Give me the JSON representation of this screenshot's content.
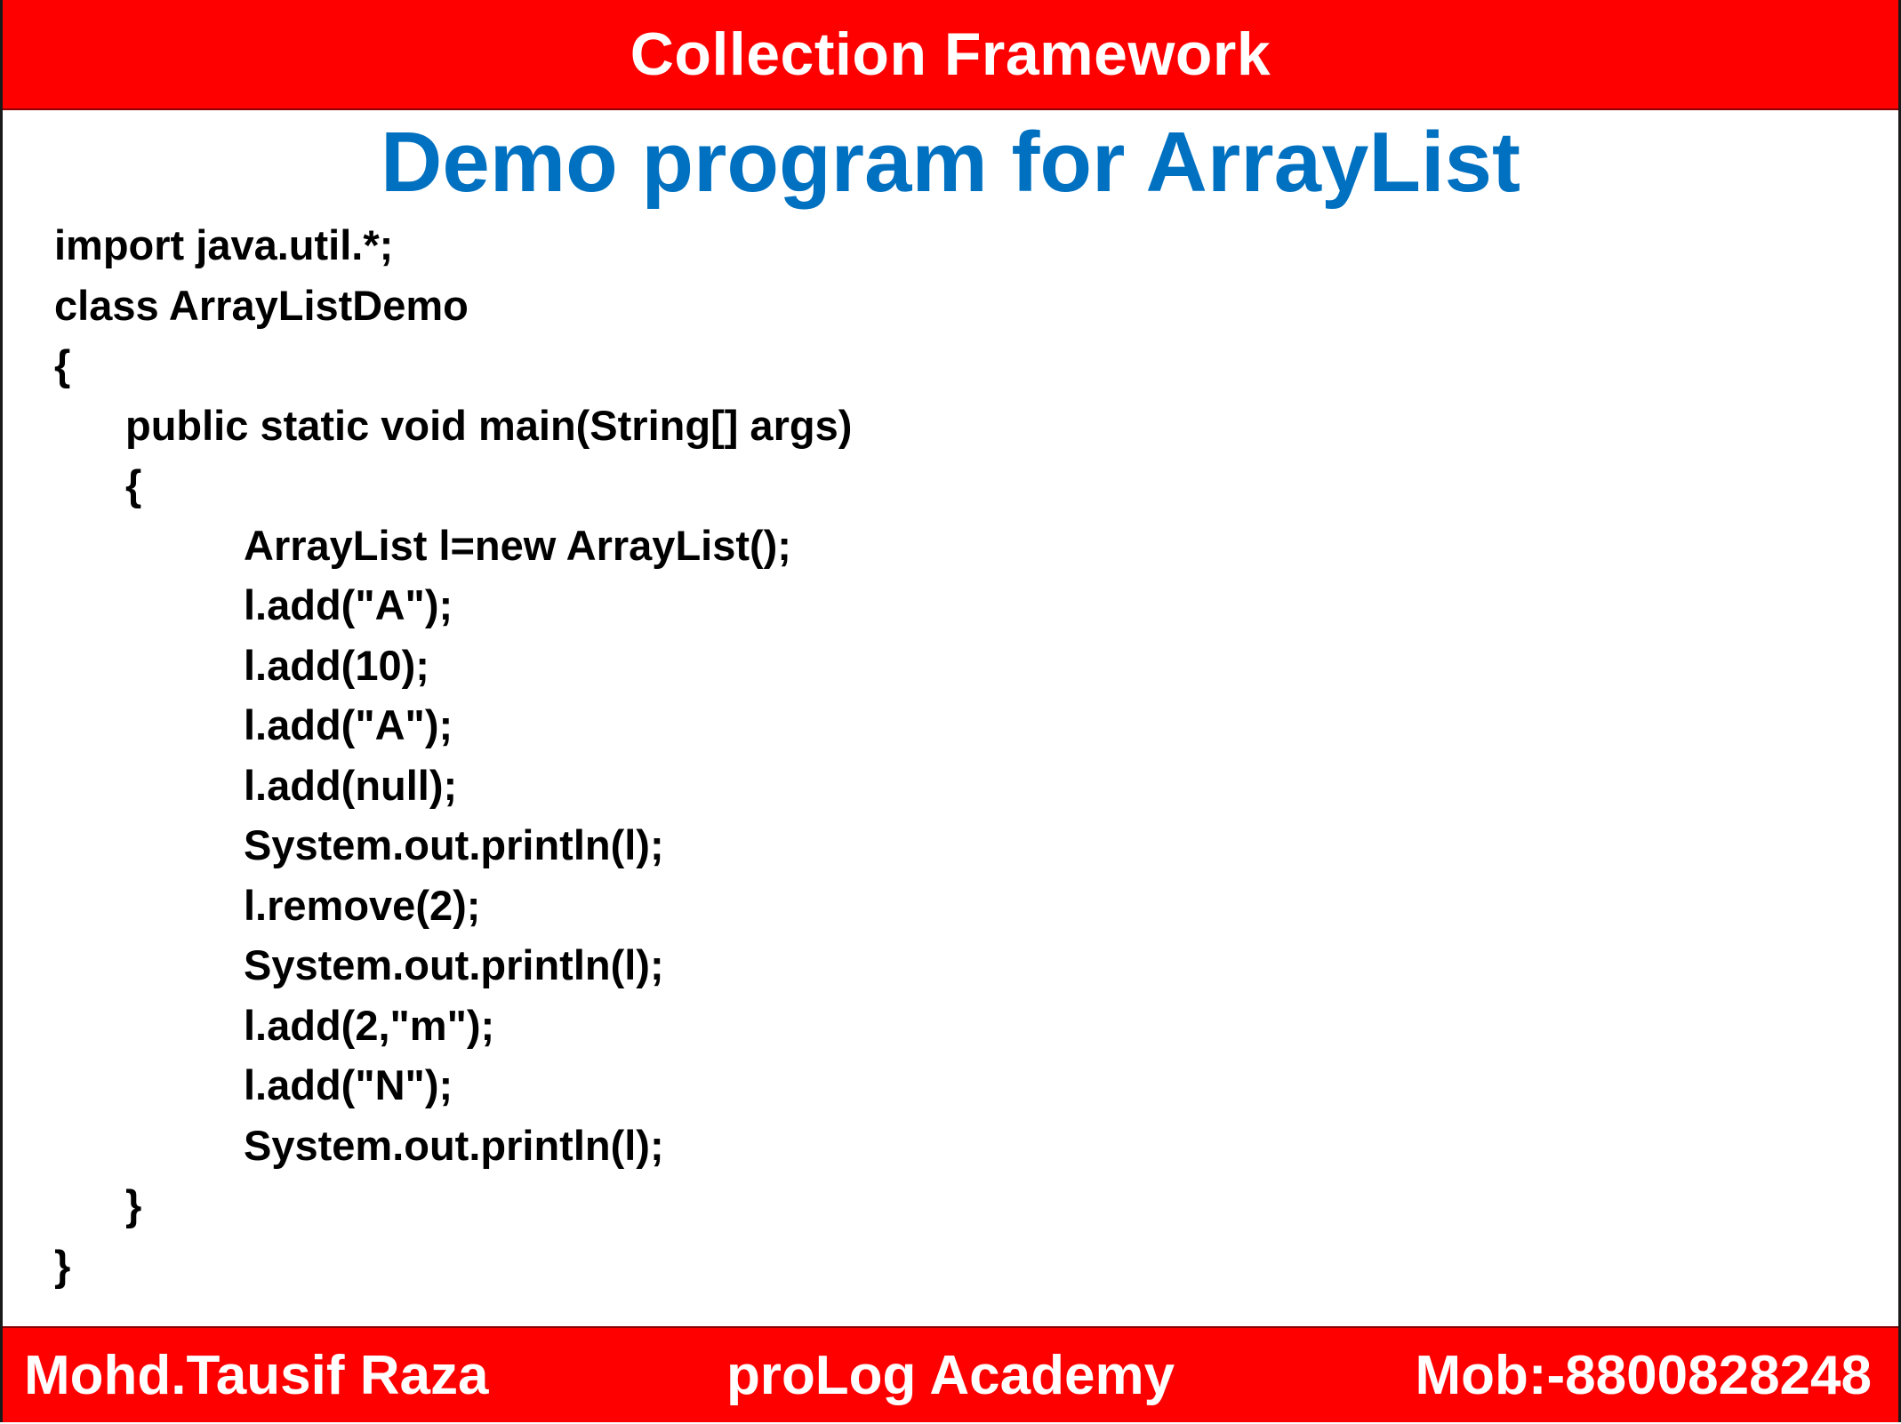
{
  "header": {
    "title": "Collection Framework",
    "background_color": "#ff0000",
    "text_color": "#ffffff"
  },
  "slide": {
    "title": "Demo program for ArrayList",
    "title_color": "#0070c0"
  },
  "code": {
    "lines": [
      {
        "indent": 0,
        "text": "import java.util.*;"
      },
      {
        "indent": 0,
        "text": "class ArrayListDemo"
      },
      {
        "indent": 0,
        "text": "{"
      },
      {
        "indent": 1,
        "text": "public static void main(String[] args)"
      },
      {
        "indent": 1,
        "text": "{"
      },
      {
        "indent": 2,
        "text": "ArrayList l=new ArrayList();"
      },
      {
        "indent": 2,
        "text": "l.add(\"A\");"
      },
      {
        "indent": 2,
        "text": "l.add(10);"
      },
      {
        "indent": 2,
        "text": "l.add(\"A\");"
      },
      {
        "indent": 2,
        "text": "l.add(null);"
      },
      {
        "indent": 2,
        "text": "System.out.println(l);"
      },
      {
        "indent": 2,
        "text": "l.remove(2);"
      },
      {
        "indent": 2,
        "text": "System.out.println(l);"
      },
      {
        "indent": 2,
        "text": "l.add(2,\"m\");"
      },
      {
        "indent": 2,
        "text": "l.add(\"N\");"
      },
      {
        "indent": 2,
        "text": "System.out.println(l);"
      },
      {
        "indent": 1,
        "text": "}"
      },
      {
        "indent": 0,
        "text": "}"
      }
    ]
  },
  "footer": {
    "author": "Mohd.Tausif Raza",
    "academy": "proLog Academy",
    "phone": "Mob:-8800828248"
  }
}
